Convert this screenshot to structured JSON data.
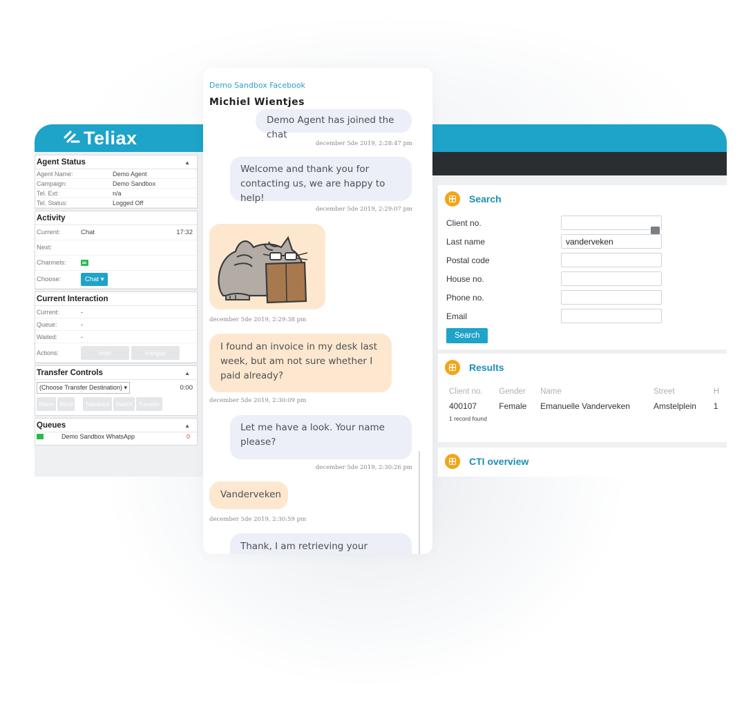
{
  "left_panel": {
    "brand": "Teliax",
    "agent_status": {
      "title": "Agent Status",
      "rows": [
        {
          "label": "Agent Name:",
          "value": "Demo Agent"
        },
        {
          "label": "Campaign:",
          "value": "Demo Sandbox"
        },
        {
          "label": "Tel. Ext:",
          "value": "n/a"
        },
        {
          "label": "Tel. Status:",
          "value": "Logged Off"
        }
      ]
    },
    "activity": {
      "title": "Activity",
      "current_label": "Current:",
      "current_value": "Chat",
      "current_time": "17:32",
      "next_label": "Next:",
      "channels_label": "Channels:",
      "choose_label": "Choose:",
      "choose_button": "Chat ▾"
    },
    "current_interaction": {
      "title": "Current Interaction",
      "rows": [
        {
          "label": "Current:",
          "value": "-"
        },
        {
          "label": "Queue:",
          "value": "-"
        },
        {
          "label": "Waited:",
          "value": "-"
        }
      ],
      "actions_label": "Actions:",
      "hold": "Hold",
      "hangup": "Hangup"
    },
    "transfer_controls": {
      "title": "Transfer Controls",
      "select_value": "(Choose Transfer Destination) ▾",
      "timer": "0:00",
      "buttons": [
        "Warm",
        "Blind",
        "Takeback",
        "Switch",
        "Transfer"
      ]
    },
    "queues": {
      "title": "Queues",
      "item": "Demo Sandbox WhatsApp",
      "count": "0"
    }
  },
  "chat": {
    "source": "Demo Sandbox Facebook",
    "contact": "Michiel Wientjes",
    "messages": [
      {
        "text": "Demo Agent has joined the chat",
        "time": "december 5de 2019, 2:28:47 pm"
      },
      {
        "text": "Welcome and thank you for contacting us, we are happy to help!",
        "time": "december 5de 2019, 2:29:07 pm"
      },
      {
        "text": "",
        "time": "december 5de 2019, 2:29:38 pm"
      },
      {
        "text": "I found an invoice in my desk last week, but am not sure whether I paid already?",
        "time": "december 5de 2019, 2:30:09 pm"
      },
      {
        "text": "Let me have a look. Your name please?",
        "time": "december 5de 2019, 2:30:26 pm"
      },
      {
        "text": "Vanderveken",
        "time": "december 5de 2019, 2:30:59 pm"
      },
      {
        "text": "Thank, I am retrieving your invoices...",
        "time": ""
      }
    ]
  },
  "search": {
    "title": "Search",
    "fields": [
      {
        "label": "Client no.",
        "value": ""
      },
      {
        "label": "Last name",
        "value": "vanderveken"
      },
      {
        "label": "Postal code",
        "value": ""
      },
      {
        "label": "House no.",
        "value": ""
      },
      {
        "label": "Phone no.",
        "value": ""
      },
      {
        "label": "Email",
        "value": ""
      }
    ],
    "button": "Search"
  },
  "results": {
    "title": "Results",
    "columns": [
      "Client no.",
      "Gender",
      "Name",
      "Street",
      "H"
    ],
    "rows": [
      [
        "400107",
        "Female",
        "Emanuelle Vanderveken",
        "Amstelplein",
        "1"
      ]
    ],
    "footer": "1 record found"
  },
  "cti": {
    "title": "CTI overview"
  },
  "colors": {
    "brand": "#1ea3c9",
    "agent_bubble": "#eceef8",
    "customer_bubble": "#fde8cf",
    "accent": "#f2a518"
  }
}
